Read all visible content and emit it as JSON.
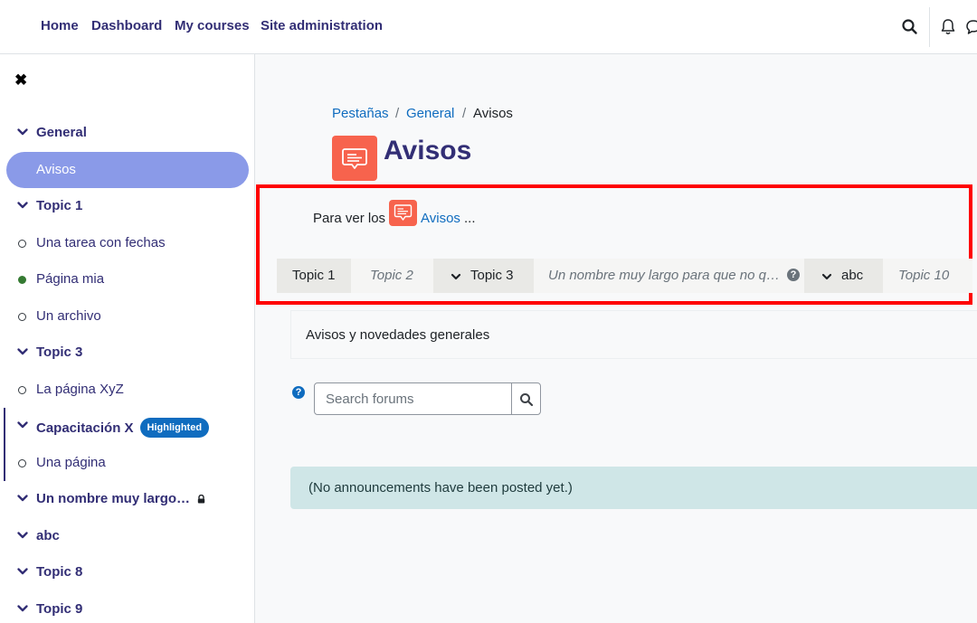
{
  "navbar": {
    "links": [
      "Home",
      "Dashboard",
      "My courses",
      "Site administration"
    ],
    "icons": [
      "search-icon",
      "bell-icon",
      "chat-icon"
    ]
  },
  "drawer": {
    "close_icon": "close-icon",
    "items": [
      {
        "label": "General",
        "type": "section"
      },
      {
        "label": "Avisos",
        "type": "activity",
        "active": true
      },
      {
        "label": "Topic 1",
        "type": "section"
      },
      {
        "label": "Una tarea con fechas",
        "type": "activity"
      },
      {
        "label": "Página mia",
        "type": "activity",
        "completed": true
      },
      {
        "label": "Un archivo",
        "type": "activity"
      },
      {
        "label": "Topic 3",
        "type": "section"
      },
      {
        "label": "La página XyZ",
        "type": "activity"
      },
      {
        "label": "Capacitación X",
        "type": "section",
        "badge": "Highlighted"
      },
      {
        "label": "Una página",
        "type": "activity"
      },
      {
        "label": "Un nombre muy largo…",
        "type": "section",
        "locked": true
      },
      {
        "label": "abc",
        "type": "section"
      },
      {
        "label": "Topic 8",
        "type": "section"
      },
      {
        "label": "Topic 9",
        "type": "section"
      }
    ]
  },
  "breadcrumb": [
    "Pestañas",
    "General",
    "Avisos"
  ],
  "page": {
    "title": "Avisos",
    "icon": "forum-icon"
  },
  "intro": {
    "prefix": "Para ver los",
    "link": "Avisos",
    "suffix": "..."
  },
  "tabs": [
    {
      "label": "Topic 1",
      "style": "dark"
    },
    {
      "label": "Topic 2",
      "style": "light"
    },
    {
      "label": "Topic 3",
      "style": "dark",
      "expandable": true
    },
    {
      "label": "Un nombre muy largo para que no q…",
      "style": "light",
      "help": "?"
    },
    {
      "label": "abc",
      "style": "dark",
      "expandable": true
    },
    {
      "label": "Topic 10",
      "style": "light"
    }
  ],
  "summary": "Avisos y novedades generales",
  "search": {
    "placeholder": "Search forums",
    "help_icon": "?"
  },
  "alert": "(No announcements have been posted yet.)",
  "colors": {
    "brand": "#322e75",
    "link": "#0f6cbf",
    "active_item": "#8a9ae8",
    "activity_icon": "#f7634d",
    "highlight_box": "#ff0000",
    "alert_bg": "#cfe6e7"
  }
}
